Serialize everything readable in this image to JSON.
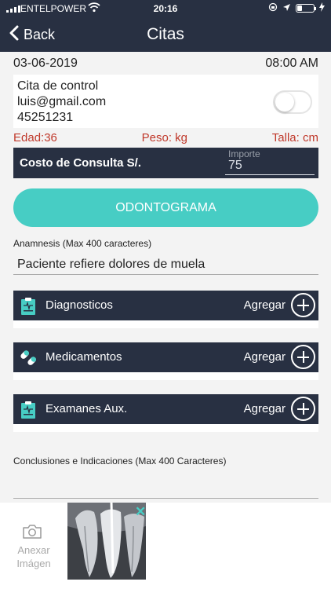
{
  "status_bar": {
    "carrier": "ENTELPOWER",
    "time": "20:16"
  },
  "nav": {
    "back_label": "Back",
    "title": "Citas"
  },
  "appointment": {
    "date": "03-06-2019",
    "time": "08:00 AM",
    "type": "Cita de control",
    "email": "luis@gmail.com",
    "phone": "45251231",
    "toggle_on": false
  },
  "metrics": {
    "edad": "Edad:36",
    "peso": "Peso: kg",
    "talla": "Talla: cm"
  },
  "cost": {
    "label": "Costo de Consulta S/.",
    "importe_placeholder": "Importe",
    "importe_value": "75"
  },
  "odontograma_label": "ODONTOGRAMA",
  "anamnesis": {
    "label": "Anamnesis (Max 400 caracteres)",
    "value": "Paciente refiere dolores de muela"
  },
  "sections": [
    {
      "name": "Diagnosticos",
      "action": "Agregar",
      "icon": "clipboard-icon"
    },
    {
      "name": "Medicamentos",
      "action": "Agregar",
      "icon": "pills-icon"
    },
    {
      "name": "Examanes Aux.",
      "action": "Agregar",
      "icon": "clipboard-icon"
    }
  ],
  "conclusiones_label": "Conclusiones e Indicaciones (Max 400 Caracteres)",
  "attach": {
    "label": "Anexar Imágen",
    "icon": "camera-icon",
    "remove_icon": "close-icon"
  },
  "colors": {
    "navy": "#283042",
    "teal": "#47cdc4",
    "red": "#c0392b"
  }
}
